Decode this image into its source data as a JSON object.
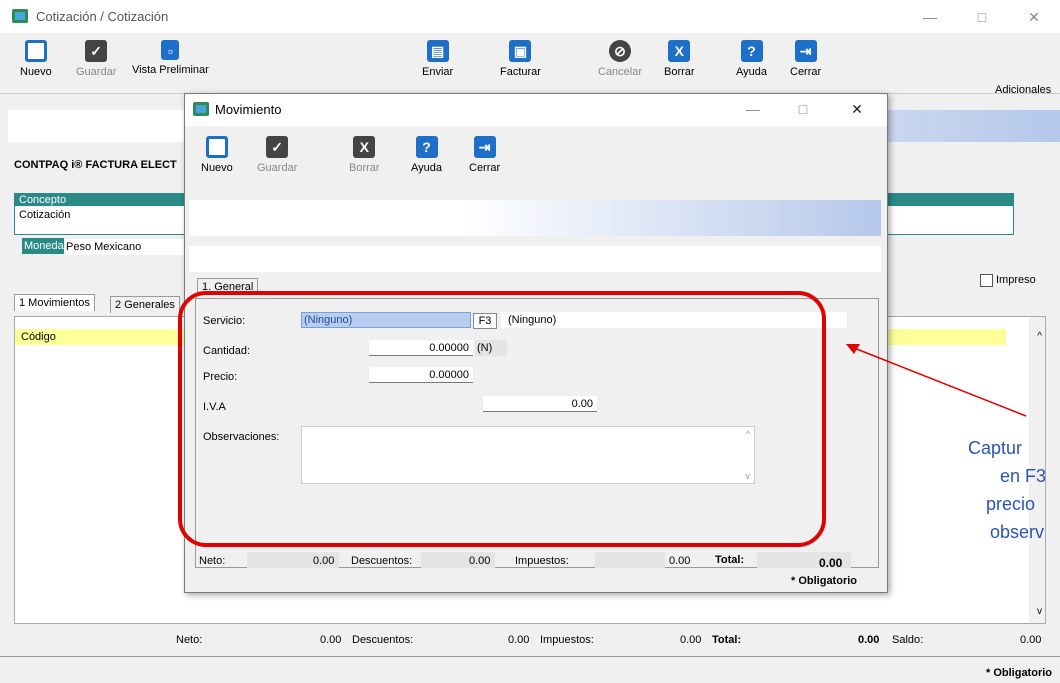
{
  "window": {
    "title": "Cotización / Cotización",
    "minimize": "—",
    "maximize": "□",
    "close": "✕"
  },
  "toolbar": {
    "nuevo": "Nuevo",
    "guardar": "Guardar",
    "vista_preliminar": "Vista Preliminar",
    "enviar": "Enviar",
    "facturar": "Facturar",
    "cancelar": "Cancelar",
    "borrar": "Borrar",
    "ayuda": "Ayuda",
    "cerrar": "Cerrar",
    "adicionales": "Adicionales"
  },
  "main": {
    "section_title": "CONTPAQ i® FACTURA ELECT",
    "concepto_label": "Concepto",
    "concepto_value": "Cotización",
    "moneda_label": "Moneda",
    "moneda_value": "Peso Mexicano",
    "impreso_label": "Impreso",
    "tabs": [
      "1 Movimientos",
      "2 Generales"
    ],
    "grid_header": "Código",
    "totals": {
      "neto_label": "Neto:",
      "neto": "0.00",
      "descuentos_label": "Descuentos:",
      "descuentos": "0.00",
      "impuestos_label": "Impuestos:",
      "impuestos": "0.00",
      "total_label": "Total:",
      "total": "0.00",
      "saldo_label": "Saldo:",
      "saldo": "0.00"
    },
    "obligatorio": "* Obligatorio"
  },
  "dialog": {
    "title": "Movimiento",
    "minimize": "—",
    "maximize": "□",
    "close": "✕",
    "toolbar": {
      "nuevo": "Nuevo",
      "guardar": "Guardar",
      "borrar": "Borrar",
      "ayuda": "Ayuda",
      "cerrar": "Cerrar"
    },
    "tab": "1. General",
    "servicio_label": "Servicio:",
    "servicio_value": "(Ninguno)",
    "f3": "F3",
    "servicio_desc": "(Ninguno)",
    "cantidad_label": "Cantidad:",
    "cantidad_value": "0.00000",
    "cantidad_unit": "(N)",
    "precio_label": "Precio:",
    "precio_value": "0.00000",
    "iva_label": "I.V.A",
    "iva_value": "0.00",
    "observaciones_label": "Observaciones:",
    "totals": {
      "neto_label": "Neto:",
      "neto": "0.00",
      "descuentos_label": "Descuentos:",
      "descuentos": "0.00",
      "impuestos_label": "Impuestos:",
      "impuestos": "0.00",
      "total_label": "Total:",
      "total": "0.00"
    },
    "obligatorio": "* Obligatorio"
  },
  "annotation": {
    "line1": "Captur",
    "line2": "en F3",
    "line3": "precio",
    "line4": "observ"
  },
  "colors": {
    "accent_blue": "#1e6fc8",
    "teal": "#2a8b86",
    "highlight_red": "#e00000",
    "grid_yellow": "#ffff99"
  }
}
